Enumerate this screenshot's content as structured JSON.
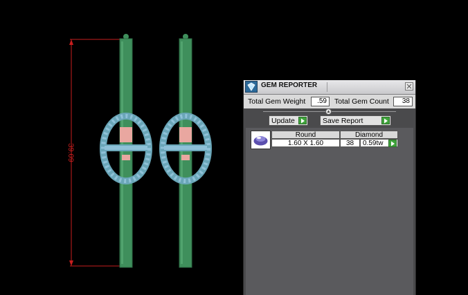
{
  "viewport": {
    "dimension_label": "39.09",
    "colors": {
      "metal": "#3f8f5c",
      "pave_stone": "#8fc1d8",
      "center_stone": "#e9a7a0",
      "dimension": "#c81e1e"
    }
  },
  "gem_reporter": {
    "title": "GEM REPORTER",
    "total_weight_label": "Total Gem Weight",
    "total_weight_value": ".59",
    "total_count_label": "Total Gem Count",
    "total_count_value": "38",
    "update_label": "Update",
    "save_report_label": "Save Report",
    "rows": [
      {
        "shape": "Round",
        "material": "Diamond",
        "size": "1.60 X 1.60",
        "count": "38",
        "weight": "0.59tw",
        "thumb_icon": "round-gem-icon"
      }
    ],
    "colors": {
      "play_button": "#3fa33b"
    }
  }
}
